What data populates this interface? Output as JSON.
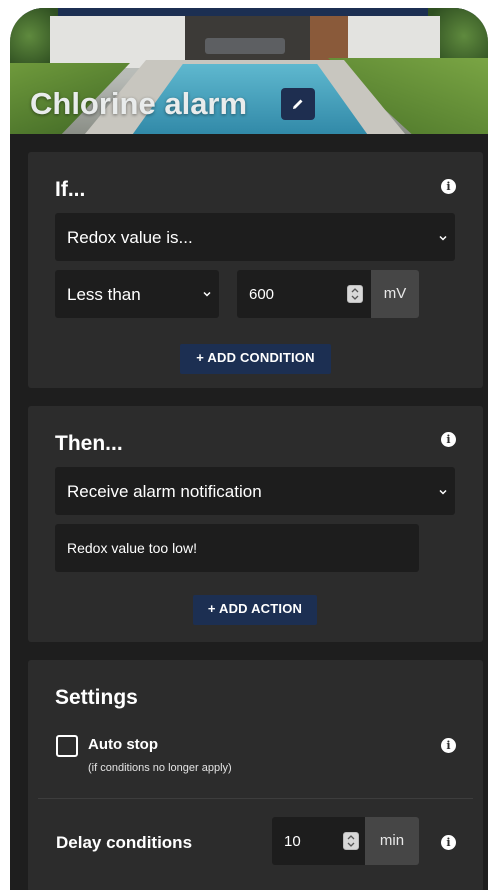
{
  "header": {
    "title": "Chlorine alarm",
    "edit_icon": "pencil-icon"
  },
  "if_card": {
    "title": "If...",
    "parameter_select": "Redox value is...",
    "comparison_select": "Less than",
    "value_input": "600",
    "unit": "mV",
    "add_condition_label": "+ ADD CONDITION"
  },
  "then_card": {
    "title": "Then...",
    "action_select": "Receive alarm notification",
    "message_input": "Redox value too low!",
    "add_action_label": "+ ADD ACTION"
  },
  "settings_card": {
    "title": "Settings",
    "auto_stop_label": "Auto stop",
    "auto_stop_checked": false,
    "auto_stop_hint": "(if conditions no longer apply)",
    "delay_label": "Delay conditions",
    "delay_value": "10",
    "delay_unit": "min"
  },
  "colors": {
    "background": "#1e1e1e",
    "card": "#2c2c2c",
    "input": "#1d1d1d",
    "accent_button": "#1c2f52",
    "unit_box": "#464646"
  }
}
